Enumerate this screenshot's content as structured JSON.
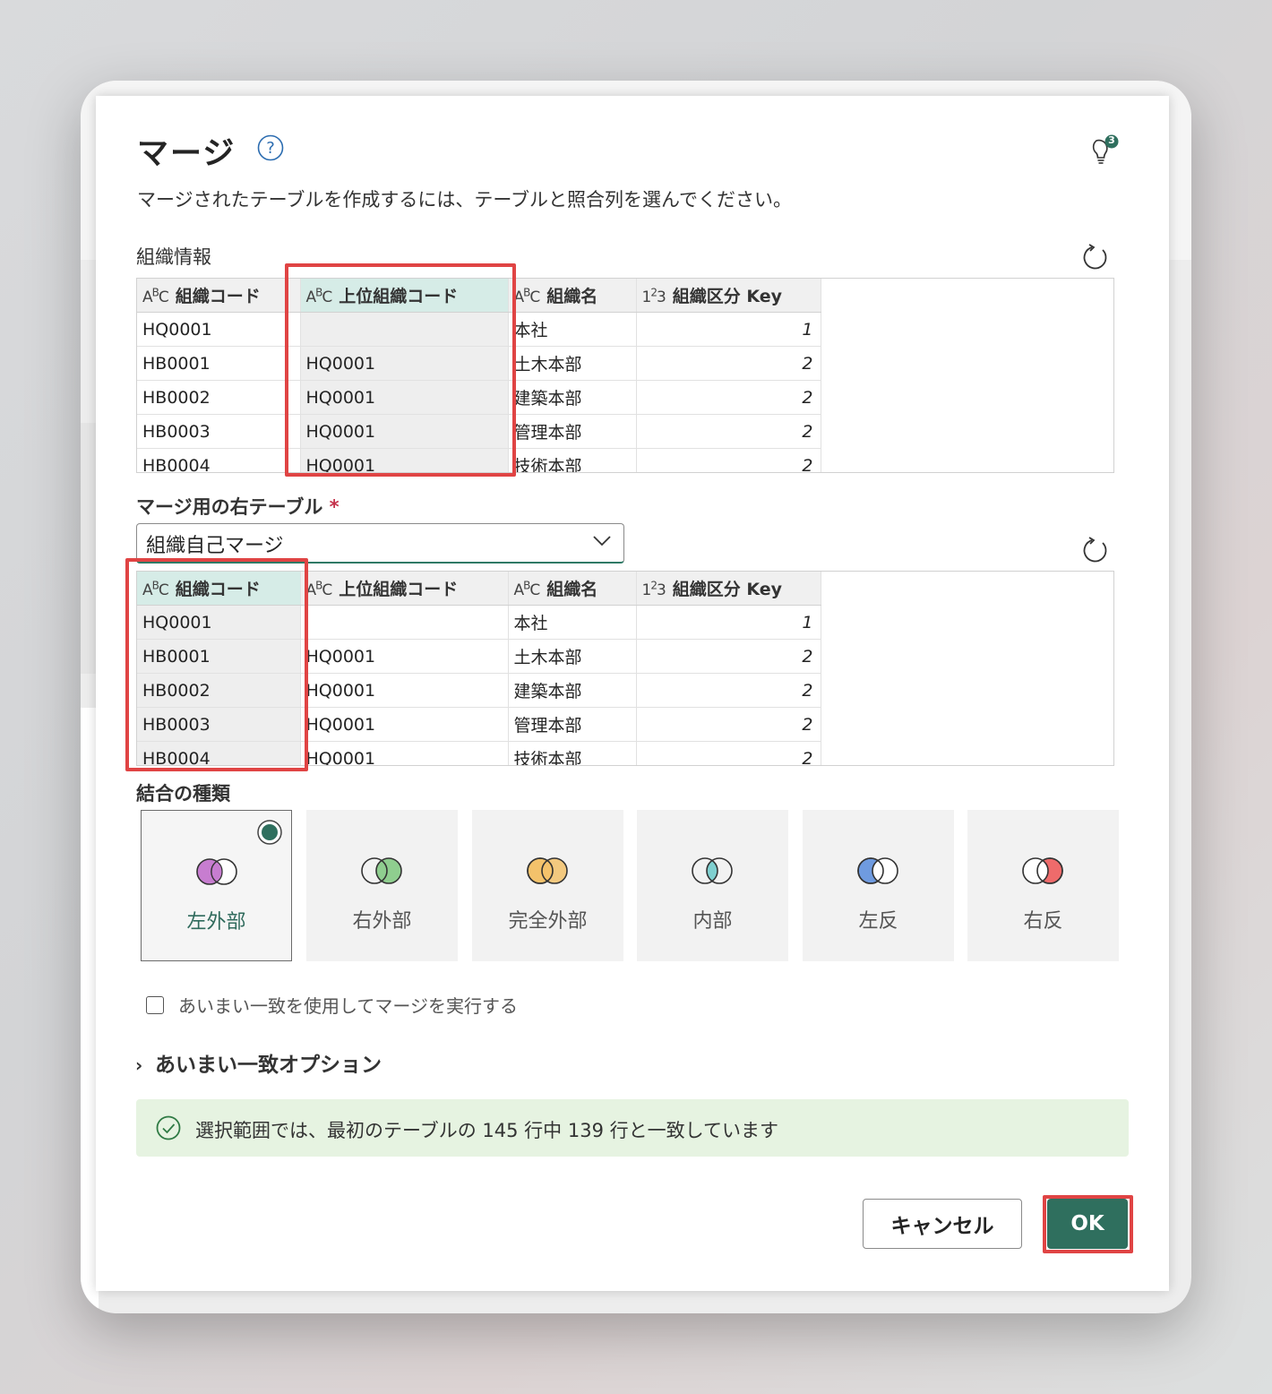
{
  "dialog": {
    "title": "マージ",
    "subtitle": "マージされたテーブルを作成するには、テーブルと照合列を選んでください。",
    "notification_count": "3"
  },
  "left_table": {
    "name": "組織情報",
    "columns": [
      {
        "type": "ABC",
        "label": "組織コード"
      },
      {
        "type": "ABC",
        "label": "上位組織コード"
      },
      {
        "type": "ABC",
        "label": "組織名"
      },
      {
        "type": "123",
        "label": "組織区分 Key"
      }
    ],
    "rows": [
      [
        "HQ0001",
        "",
        "本社",
        "1"
      ],
      [
        "HB0001",
        "HQ0001",
        "土木本部",
        "2"
      ],
      [
        "HB0002",
        "HQ0001",
        "建築本部",
        "2"
      ],
      [
        "HB0003",
        "HQ0001",
        "管理本部",
        "2"
      ],
      [
        "HB0004",
        "HQ0001",
        "技術本部",
        "2"
      ]
    ],
    "selected_column": "上位組織コード"
  },
  "right_table": {
    "label": "マージ用の右テーブル",
    "required_marker": "*",
    "selected_value": "組織自己マージ",
    "columns": [
      {
        "type": "ABC",
        "label": "組織コード"
      },
      {
        "type": "ABC",
        "label": "上位組織コード"
      },
      {
        "type": "ABC",
        "label": "組織名"
      },
      {
        "type": "123",
        "label": "組織区分 Key"
      }
    ],
    "rows": [
      [
        "HQ0001",
        "",
        "本社",
        "1"
      ],
      [
        "HB0001",
        "HQ0001",
        "土木本部",
        "2"
      ],
      [
        "HB0002",
        "HQ0001",
        "建築本部",
        "2"
      ],
      [
        "HB0003",
        "HQ0001",
        "管理本部",
        "2"
      ],
      [
        "HB0004",
        "HQ0001",
        "技術本部",
        "2"
      ]
    ],
    "selected_column": "組織コード"
  },
  "join": {
    "label": "結合の種類",
    "options": [
      {
        "label": "左外部",
        "color": "#c77dd0",
        "selected": true
      },
      {
        "label": "右外部",
        "color": "#8fce8f",
        "selected": false
      },
      {
        "label": "完全外部",
        "color": "#f3c26b",
        "selected": false
      },
      {
        "label": "内部",
        "color": "#7fd0d0",
        "selected": false
      },
      {
        "label": "左反",
        "color": "#6f9be0",
        "selected": false
      },
      {
        "label": "右反",
        "color": "#ee6b6b",
        "selected": false
      }
    ]
  },
  "fuzzy": {
    "checkbox_label": "あいまい一致を使用してマージを実行する",
    "checked": false,
    "options_label": "あいまい一致オプション"
  },
  "status": {
    "message": "選択範囲では、最初のテーブルの 145 行中 139 行と一致しています"
  },
  "buttons": {
    "cancel": "キャンセル",
    "ok": "OK"
  },
  "colors": {
    "accent": "#2f6f5e",
    "highlight": "#e04444",
    "status_bg": "#e6f3e1"
  }
}
